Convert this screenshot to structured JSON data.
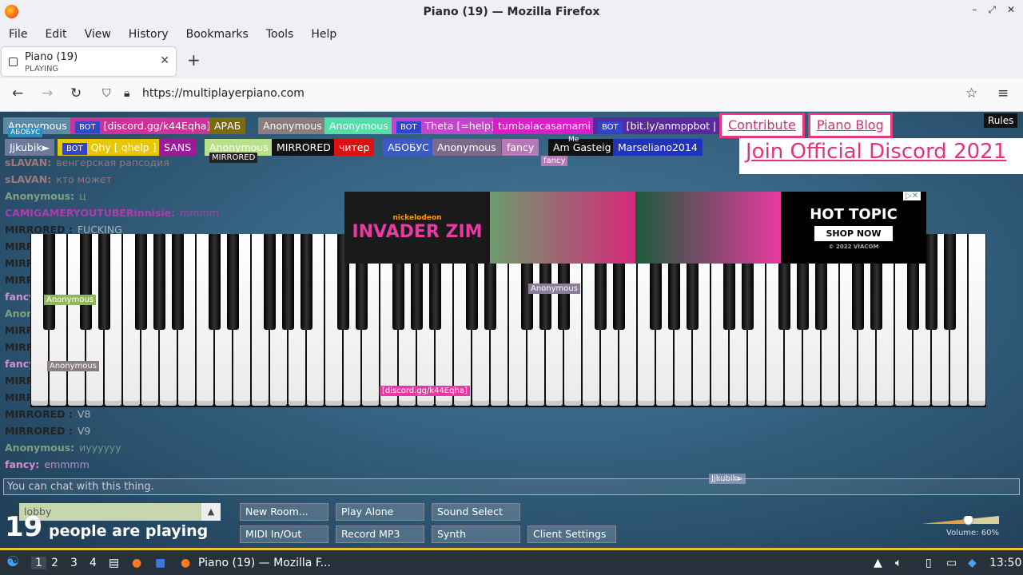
{
  "window": {
    "title": "Piano (19) — Mozilla Firefox"
  },
  "menu": [
    "File",
    "Edit",
    "View",
    "History",
    "Bookmarks",
    "Tools",
    "Help"
  ],
  "tab": {
    "title": "Piano (19)",
    "status": "PLAYING"
  },
  "address": {
    "url": "https://multiplayerpiano.com"
  },
  "users_row1": [
    {
      "name": "Anonymous",
      "color": "#5f8aa6",
      "bot": false
    },
    {
      "name": "[discord.gg/k44Eqha]",
      "color": "#cc3399",
      "bot": true
    },
    {
      "name": "АРАБ",
      "color": "#7a6a14",
      "bot": false
    },
    {
      "name": "Anonymous",
      "color": "#8a7d7d",
      "bot": false
    },
    {
      "name": "Anonymous",
      "color": "#55ddaa",
      "bot": false
    },
    {
      "name": "Theta [=help]",
      "color": "#c246c9",
      "bot": true
    },
    {
      "name": "tumbalacasamami",
      "color": "#d81fc7",
      "bot": false
    },
    {
      "name": "[bit.ly/anmppbot | -",
      "color": "#5b2a9a",
      "bot": true
    }
  ],
  "users_row2": [
    {
      "name": "Jjkubik►",
      "color": "#6e7a9a",
      "bot": false
    },
    {
      "name": "Qhy [ qhelp ]",
      "color": "#e6c800",
      "bot": true
    },
    {
      "name": "SANS",
      "color": "#9d1a9d",
      "bot": false
    },
    {
      "name": "Anonymous",
      "color": "#b9e08a",
      "bot": false
    },
    {
      "name": "MIRRORED",
      "color": "#111111",
      "bot": false
    },
    {
      "name": "читер",
      "color": "#dd1111",
      "bot": false
    },
    {
      "name": "АБОБУС",
      "color": "#3a5ac9",
      "bot": false
    },
    {
      "name": "Anonymous",
      "color": "#7d6a8a",
      "bot": false
    },
    {
      "name": "fancy",
      "color": "#b57ab5",
      "bot": false
    },
    {
      "name": "Am Gasteig",
      "color": "#111111",
      "bot": false
    },
    {
      "name": "Marseliano2014",
      "color": "#2233bb",
      "bot": false
    }
  ],
  "badges": {
    "abobus": "АБОБУС",
    "mirrored": "MIRRORED",
    "fancy": "fancy",
    "me": "Me"
  },
  "chat": [
    {
      "name": "sLAVAN:",
      "msg": "венгерская рапсодия",
      "color": "#a07a7a"
    },
    {
      "name": "sLAVAN:",
      "msg": "кто может",
      "color": "#a07a7a"
    },
    {
      "name": "Anonymous:",
      "msg": "ц",
      "color": "#7fa07f"
    },
    {
      "name": "CAMIGAMERYOUTUBERinnisie:",
      "msg": "mmmm",
      "color": "#b03bb0"
    },
    {
      "name": "MIRRORED :",
      "msg": "FUCKING",
      "color": "#222"
    },
    {
      "name": "MIRRORED :",
      "msg": "",
      "color": "#222"
    },
    {
      "name": "MIRRORED :",
      "msg": "",
      "color": "#222"
    },
    {
      "name": "MIRRORED :",
      "msg": "",
      "color": "#222"
    },
    {
      "name": "fancy:",
      "msg": "",
      "color": "#d28fd2"
    },
    {
      "name": "Anonymous:",
      "msg": "",
      "color": "#7fa07f"
    },
    {
      "name": "MIRRORED :",
      "msg": "",
      "color": "#222"
    },
    {
      "name": "MIRRORED :",
      "msg": "",
      "color": "#222"
    },
    {
      "name": "fancy:",
      "msg": "",
      "color": "#d28fd2"
    },
    {
      "name": "MIRRORED :",
      "msg": "",
      "color": "#222"
    },
    {
      "name": "MIRRORED :",
      "msg": "",
      "color": "#222"
    },
    {
      "name": "MIRRORED :",
      "msg": "V8",
      "color": "#222"
    },
    {
      "name": "MIRRORED :",
      "msg": "V9",
      "color": "#222"
    },
    {
      "name": "Anonymous:",
      "msg": "иуууууу",
      "color": "#7fa07f"
    },
    {
      "name": "fancy:",
      "msg": "emmmm",
      "color": "#d28fd2"
    }
  ],
  "cursors": {
    "c1": "Anonymous",
    "c2": "Anonymous",
    "c3": "Anonymous",
    "c4": "[discord.gg/k44Eqha]",
    "c5": "Jjkubik►"
  },
  "ad": {
    "brand": "nickelodeon",
    "title": "INVADER ZIM",
    "store": "HOT TOPIC",
    "cta": "SHOP NOW",
    "copy": "© 2022 VIACOM"
  },
  "links": {
    "contribute": "Contribute",
    "blog": "Piano Blog",
    "discord": "Join Official Discord 2021",
    "rules": "Rules"
  },
  "chat_placeholder": "You can chat with this thing.",
  "room": "lobby",
  "people": {
    "count": "19",
    "label": "people are playing"
  },
  "buttons": {
    "new_room": "New Room...",
    "play_alone": "Play Alone",
    "sound_select": "Sound Select",
    "midi": "MIDI In/Out",
    "record": "Record MP3",
    "synth": "Synth",
    "client_settings": "Client Settings"
  },
  "volume": {
    "label": "Volume: 60%",
    "level": 0.6
  },
  "taskbar": {
    "workspaces": [
      "1",
      "2",
      "3",
      "4"
    ],
    "window": "Piano (19) — Mozilla F...",
    "clock": "13:50"
  }
}
